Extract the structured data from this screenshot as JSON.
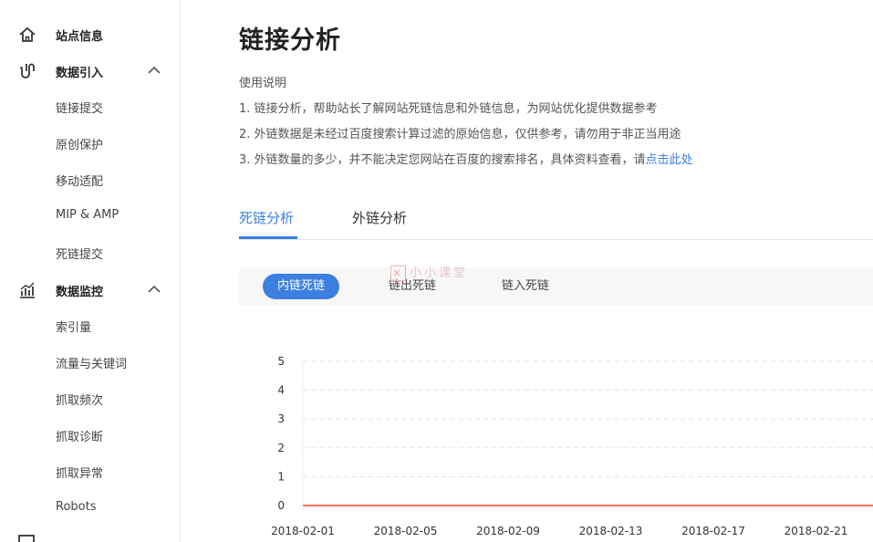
{
  "sidebar": {
    "site_info": "站点信息",
    "data_import": {
      "label": "数据引入",
      "items": [
        "链接提交",
        "原创保护",
        "移动适配",
        "MIP & AMP",
        "死链提交"
      ]
    },
    "data_monitor": {
      "label": "数据监控",
      "items": [
        "索引量",
        "流量与关键词",
        "抓取频次",
        "抓取诊断",
        "抓取异常",
        "Robots"
      ]
    }
  },
  "page": {
    "title": "链接分析",
    "usage_label": "使用说明",
    "lines": [
      "1. 链接分析，帮助站长了解网站死链信息和外链信息，为网站优化提供数据参考",
      "2. 外链数据是未经过百度搜索计算过滤的原始信息，仅供参考，请勿用于非正当用途",
      "3. 外链数量的多少，并不能决定您网站在百度的搜索排名，具体资料查看，请"
    ],
    "link_text": "点击此处"
  },
  "tabs": [
    "死链分析",
    "外链分析"
  ],
  "subtabs": [
    "内链死链",
    "链出死链",
    "链入死链"
  ],
  "watermark": "小小课堂",
  "colors": {
    "accent": "#3b80e0",
    "line": "#f0705a"
  },
  "chart_data": {
    "type": "line",
    "x": [
      "2018-02-01",
      "2018-02-05",
      "2018-02-09",
      "2018-02-13",
      "2018-02-17",
      "2018-02-21"
    ],
    "y_ticks": [
      0,
      1,
      2,
      3,
      4,
      5
    ],
    "ylim": [
      0,
      5
    ],
    "grid": true,
    "series": [
      {
        "values": [
          0,
          0,
          0,
          0,
          0,
          0
        ]
      }
    ]
  }
}
